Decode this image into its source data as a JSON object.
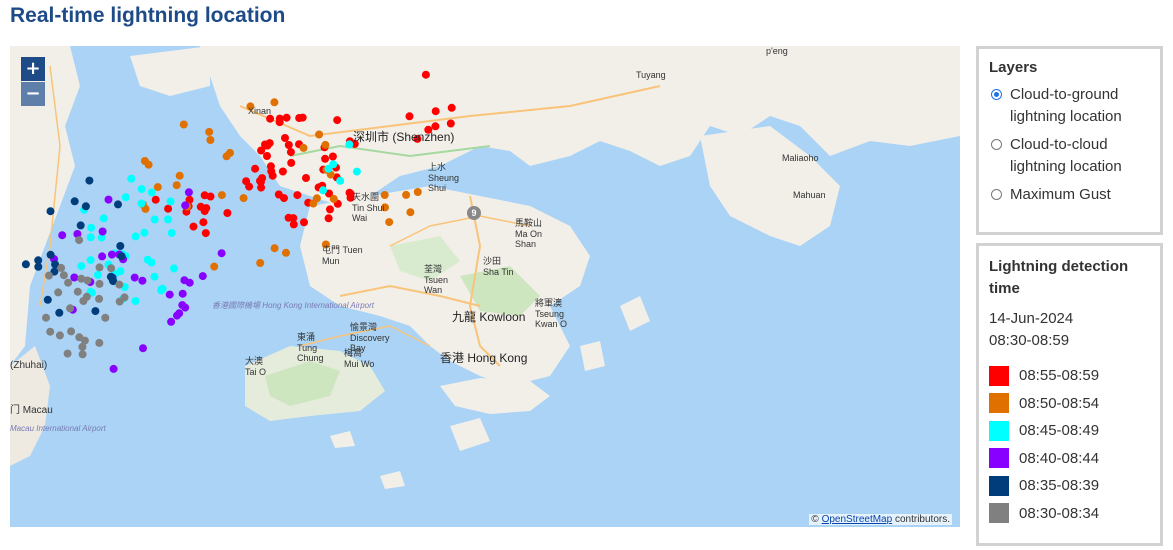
{
  "page": {
    "title": "Real-time lightning location"
  },
  "map": {
    "zoom_in": "+",
    "zoom_out": "−",
    "attribution_prefix": "©",
    "attribution_link": "OpenStreetMap",
    "attribution_suffix": "contributors.",
    "labels": {
      "shenzhen": "深圳市 (Shenzhen)",
      "sheung_shui": "上水 Sheung Shui",
      "tin_shui_wai": "天水圍 Tin Shui Wai",
      "tuen_mun": "屯門 Tuen Mun",
      "tsuen_wan": "荃灣 Tsuen Wan",
      "sha_tin": "沙田 Sha Tin",
      "ma_on_shan": "馬鞍山 Ma On Shan",
      "kowloon": "九龍 Kowloon",
      "tseung_kwan_o": "將軍澳 Tseung Kwan O",
      "hong_kong": "香港 Hong Kong",
      "tung_chung": "東涌 Tung Chung",
      "discovery_bay": "愉景灣 Discovery Bay",
      "mui_wo": "梅窩 Mui Wo",
      "tai_o": "大澳 Tai O",
      "hk_airport": "香港國際機場 Hong Kong International Airport",
      "macau_airport": "Macau International Airport",
      "xinan": "Xinan",
      "zhuhai": "(Zhuhai)",
      "macau": "门 Macau",
      "peng": "p'eng",
      "tuyang": "Tuyang",
      "maliaoho": "Maliaoho",
      "mahuan": "Mahuan",
      "route9": "9"
    }
  },
  "layers": {
    "title": "Layers",
    "options": [
      {
        "label": "Cloud-to-ground lightning location",
        "selected": true
      },
      {
        "label": "Cloud-to-cloud lightning location",
        "selected": false
      },
      {
        "label": "Maximum Gust",
        "selected": false
      }
    ]
  },
  "detection": {
    "title": "Lightning detection time",
    "date": "14-Jun-2024",
    "range": "08:30-08:59",
    "legend": [
      {
        "label": "08:55-08:59",
        "color": "#ff0000"
      },
      {
        "label": "08:50-08:54",
        "color": "#e07000"
      },
      {
        "label": "08:45-08:49",
        "color": "#00ffff"
      },
      {
        "label": "08:40-08:44",
        "color": "#8800ff"
      },
      {
        "label": "08:35-08:39",
        "color": "#003d7a"
      },
      {
        "label": "08:30-08:34",
        "color": "#808080"
      }
    ]
  }
}
